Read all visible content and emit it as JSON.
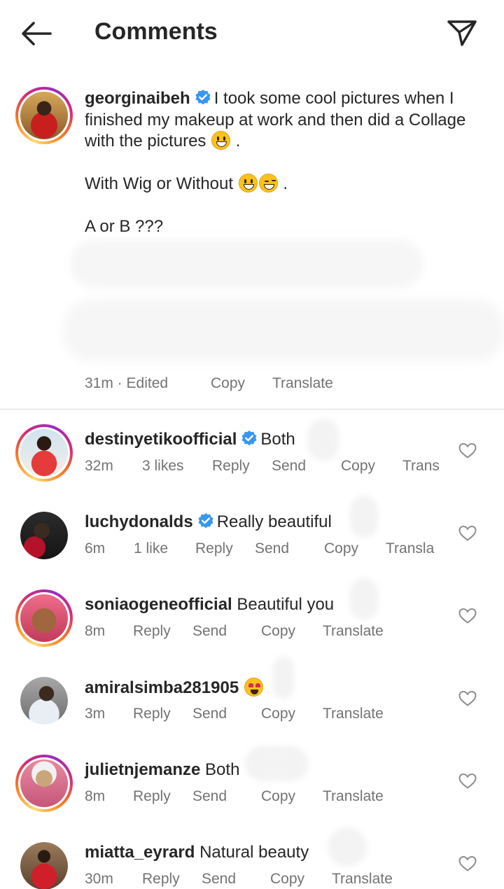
{
  "header": {
    "title": "Comments"
  },
  "caption": {
    "username": "georginaibeh",
    "line1": "I took some cool pictures when I finished my makeup at work and then did a Collage with the pictures",
    "line1_end": ".",
    "line2": "With Wig or Without",
    "line2_end": ".",
    "line3": "A or B ???",
    "time": "31m · Edited",
    "copy": "Copy",
    "translate": "Translate"
  },
  "comments": [
    {
      "username": "destinyetikoofficial",
      "verified": true,
      "text": "Both",
      "time": "32m",
      "likes": "3 likes",
      "reply": "Reply",
      "send": "Send",
      "copy": "Copy",
      "translate": "Trans"
    },
    {
      "username": "luchydonalds",
      "verified": true,
      "text": "Really beautiful",
      "time": "6m",
      "likes": "1 like",
      "reply": "Reply",
      "send": "Send",
      "copy": "Copy",
      "translate": "Transla"
    },
    {
      "username": "soniaogeneofficial",
      "verified": false,
      "text": "Beautiful you",
      "time": "8m",
      "reply": "Reply",
      "send": "Send",
      "copy": "Copy",
      "translate": "Translate"
    },
    {
      "username": "amiralsimba281905",
      "verified": false,
      "text": "",
      "time": "3m",
      "reply": "Reply",
      "send": "Send",
      "copy": "Copy",
      "translate": "Translate"
    },
    {
      "username": "julietnjemanze",
      "verified": false,
      "text": "Both",
      "time": "8m",
      "reply": "Reply",
      "send": "Send",
      "copy": "Copy",
      "translate": "Translate"
    },
    {
      "username": "miatta_eyrard",
      "verified": false,
      "text": "Natural beauty",
      "time": "30m",
      "reply": "Reply",
      "send": "Send",
      "copy": "Copy",
      "translate": "Translate"
    }
  ],
  "icons": {
    "back": "arrow-left-icon",
    "send": "paper-plane-icon",
    "verified": "verified-badge-icon",
    "like": "heart-outline-icon"
  },
  "colors": {
    "verified": "#3897f0",
    "meta": "#737373",
    "text": "#262626",
    "divider": "#dbdbdb"
  }
}
